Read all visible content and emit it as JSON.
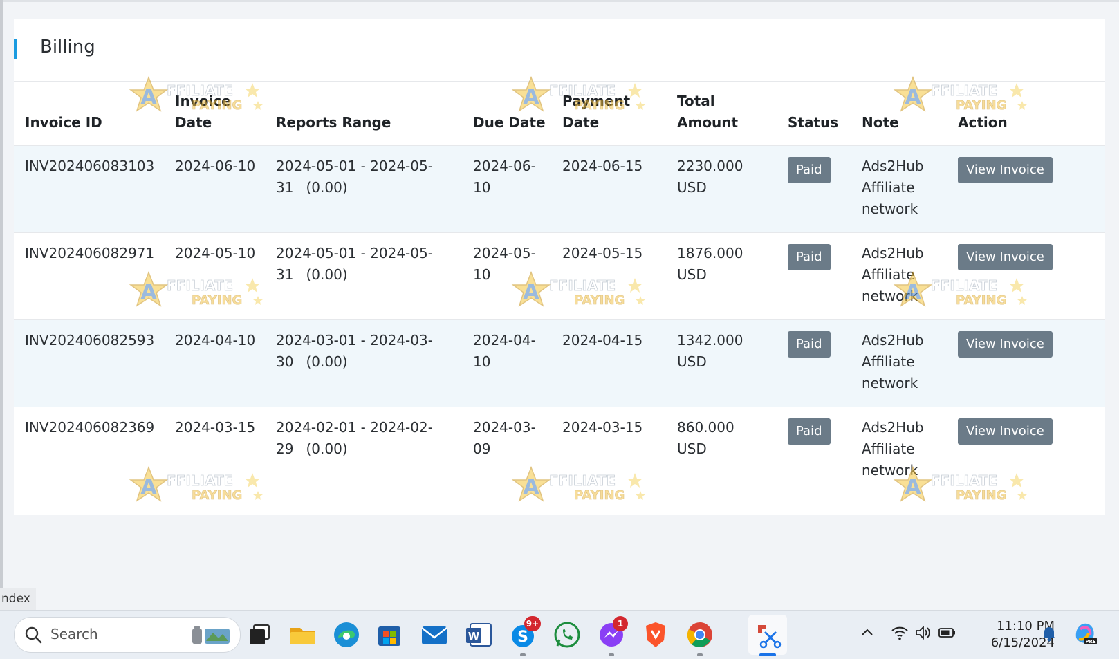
{
  "page": {
    "title": "Billing",
    "side_tab": "ndex"
  },
  "table": {
    "headers": {
      "invoice_id": "Invoice ID",
      "invoice_date": "Invoice Date",
      "reports_range": "Reports Range",
      "due_date": "Due Date",
      "payment_date": "Payment Date",
      "total_amount": "Total Amount",
      "status": "Status",
      "note": "Note",
      "action": "Action"
    },
    "rows": [
      {
        "invoice_id": "INV202406083103",
        "invoice_date": "2024-06-10",
        "range": "2024-05-01 - 2024-05-31",
        "range_note": "(0.00)",
        "due_date": "2024-06-10",
        "payment_date": "2024-06-15",
        "total_amount": "2230.000 USD",
        "status": "Paid",
        "note": "Ads2Hub Affiliate network",
        "action": "View Invoice"
      },
      {
        "invoice_id": "INV202406082971",
        "invoice_date": "2024-05-10",
        "range": "2024-05-01 - 2024-05-31",
        "range_note": "(0.00)",
        "due_date": "2024-05-10",
        "payment_date": "2024-05-15",
        "total_amount": "1876.000 USD",
        "status": "Paid",
        "note": "Ads2Hub Affiliate network",
        "action": "View Invoice"
      },
      {
        "invoice_id": "INV202406082593",
        "invoice_date": "2024-04-10",
        "range": "2024-03-01 - 2024-03-30",
        "range_note": "(0.00)",
        "due_date": "2024-04-10",
        "payment_date": "2024-04-15",
        "total_amount": "1342.000 USD",
        "status": "Paid",
        "note": "Ads2Hub Affiliate network",
        "action": "View Invoice"
      },
      {
        "invoice_id": "INV202406082369",
        "invoice_date": "2024-03-15",
        "range": "2024-02-01 - 2024-02-29",
        "range_note": "(0.00)",
        "due_date": "2024-03-09",
        "payment_date": "2024-03-15",
        "total_amount": "860.000 USD",
        "status": "Paid",
        "note": "Ads2Hub Affiliate network",
        "action": "View Invoice"
      }
    ]
  },
  "watermark": {
    "line1": "AFFILIATE",
    "line2": "PAYING"
  },
  "taskbar": {
    "search_placeholder": "Search",
    "skype_badge": "9+",
    "messenger_badge": "1",
    "time": "11:10 PM",
    "date": "6/15/2024"
  },
  "colors": {
    "accent": "#1a9be0",
    "badge": "#6b7b88",
    "stripe": "#f0f7fb"
  }
}
